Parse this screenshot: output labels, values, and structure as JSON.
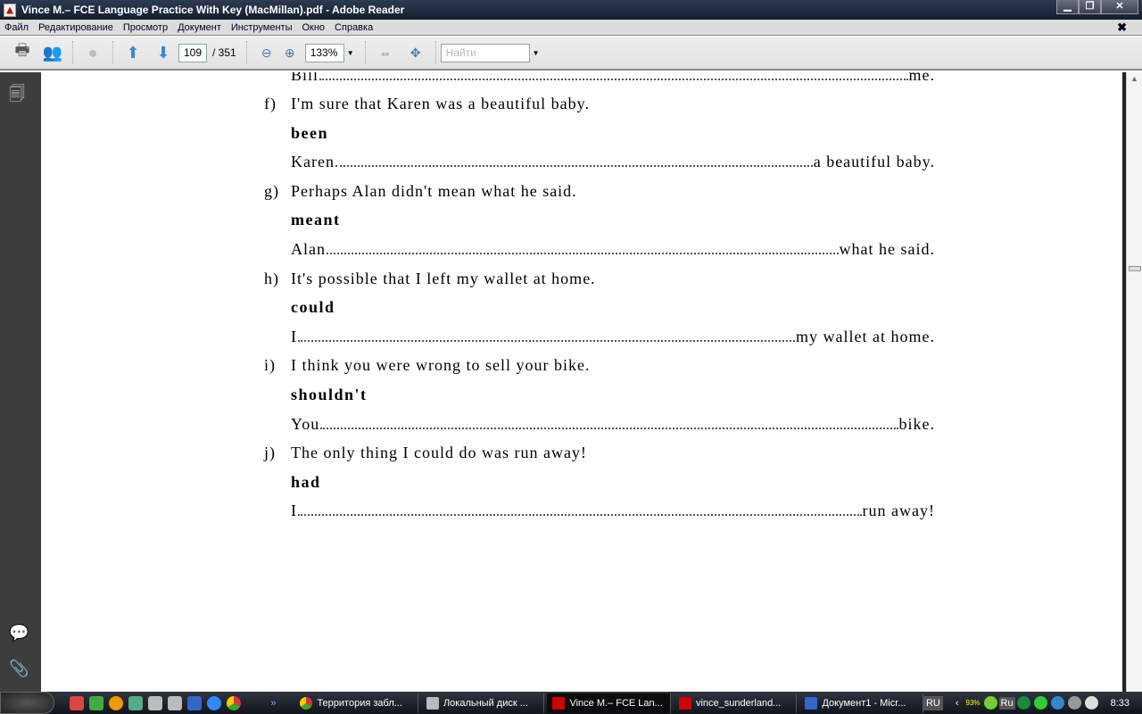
{
  "window": {
    "title": "Vince M.– FCE Language Practice With Key (MacMillan).pdf - Adobe Reader"
  },
  "menu": [
    "Файл",
    "Редактирование",
    "Просмотр",
    "Документ",
    "Инструменты",
    "Окно",
    "Справка"
  ],
  "toolbar": {
    "page": "109",
    "page_total": "/ 351",
    "zoom": "133%",
    "search_placeholder": "Найти"
  },
  "doc": {
    "partial_line": {
      "prefix": "Bill",
      "suffix": "me."
    },
    "items": [
      {
        "letter": "f)",
        "sentence": "I'm sure that Karen was a beautiful baby.",
        "keyword": "been",
        "prefix": "Karen",
        "suffix": "a beautiful baby."
      },
      {
        "letter": "g)",
        "sentence": "Perhaps Alan didn't mean what he said.",
        "keyword": "meant",
        "prefix": "Alan",
        "suffix": "what he said."
      },
      {
        "letter": "h)",
        "sentence": "It's possible that I left my wallet at home.",
        "keyword": "could",
        "prefix": "I",
        "suffix": "my wallet at home."
      },
      {
        "letter": "i)",
        "sentence": "I think you were wrong to sell your bike.",
        "keyword": "shouldn't",
        "prefix": "You",
        "suffix": "bike."
      },
      {
        "letter": "j)",
        "sentence": "The only thing I could do was run away!",
        "keyword": "had",
        "prefix": "I",
        "suffix": "run away!"
      }
    ]
  },
  "taskbar": {
    "tasks": [
      "Территория забл...",
      "Локальный диск ...",
      "Vince M.– FCE Lan...",
      "vince_sunderland...",
      "Документ1 - Micr..."
    ],
    "lang": "RU",
    "battery": "93%",
    "tray_lang": "Ru",
    "clock": "8:33"
  }
}
